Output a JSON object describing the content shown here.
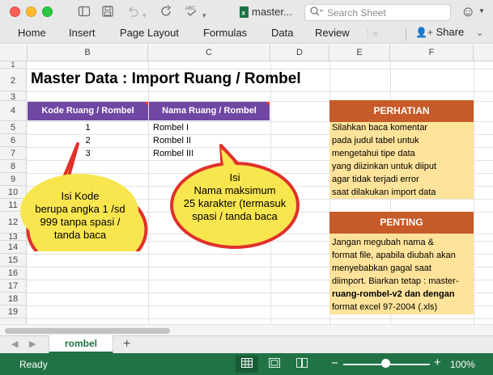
{
  "window": {
    "doc_title": "master...",
    "search_placeholder": "Search Sheet"
  },
  "ribbon": {
    "tabs": [
      "Home",
      "Insert",
      "Page Layout",
      "Formulas",
      "Data",
      "Review"
    ],
    "share_label": "Share"
  },
  "columns": [
    "B",
    "C",
    "D",
    "E",
    "F"
  ],
  "rows": [
    "1",
    "2",
    "3",
    "4",
    "5",
    "6",
    "7",
    "8",
    "9",
    "10",
    "11",
    "12",
    "13",
    "14",
    "15",
    "16",
    "17",
    "18",
    "19"
  ],
  "sheet": {
    "title": "Master Data : Import Ruang / Rombel",
    "headers": [
      "Kode Ruang / Rombel",
      "Nama Ruang / Rombel"
    ],
    "data_rows": [
      {
        "kode": "1",
        "nama": "Rombel I"
      },
      {
        "kode": "2",
        "nama": "Rombel II"
      },
      {
        "kode": "3",
        "nama": "Rombel III"
      }
    ],
    "perhatian_title": "PERHATIAN",
    "perhatian_lines": [
      "Silahkan baca komentar",
      "pada judul tabel untuk",
      "mengetahui  tipe data",
      "yang diizinkan untuk diiput",
      "agar tidak terjadi error",
      "saat dilakukan import data"
    ],
    "penting_title": "PENTING",
    "penting_lines": [
      "Jangan megubah nama &",
      "format file, apabila diubah akan",
      "menyebabkan gagal saat",
      "diimport. Biarkan tetap : master-",
      "ruang-rombel-v2 dan dengan",
      "format excel 97-2004 (.xls)"
    ]
  },
  "callouts": {
    "left": [
      "Isi Kode",
      "berupa angka 1 /sd",
      "999 tanpa spasi /",
      "tanda baca"
    ],
    "right": [
      "Isi",
      "Nama maksimum",
      "25 karakter (termasuk",
      "spasi / tanda baca"
    ]
  },
  "sheet_tabs": {
    "active": "rombel",
    "add": "+"
  },
  "status": {
    "ready": "Ready",
    "zoom": "100%"
  },
  "colors": {
    "header_purple": "#7048a3",
    "orange": "#c65a28",
    "yellow_box": "#ffe39a",
    "callout_fill": "#f9e64f",
    "callout_stroke": "#e0312b",
    "excel_green": "#217346"
  }
}
